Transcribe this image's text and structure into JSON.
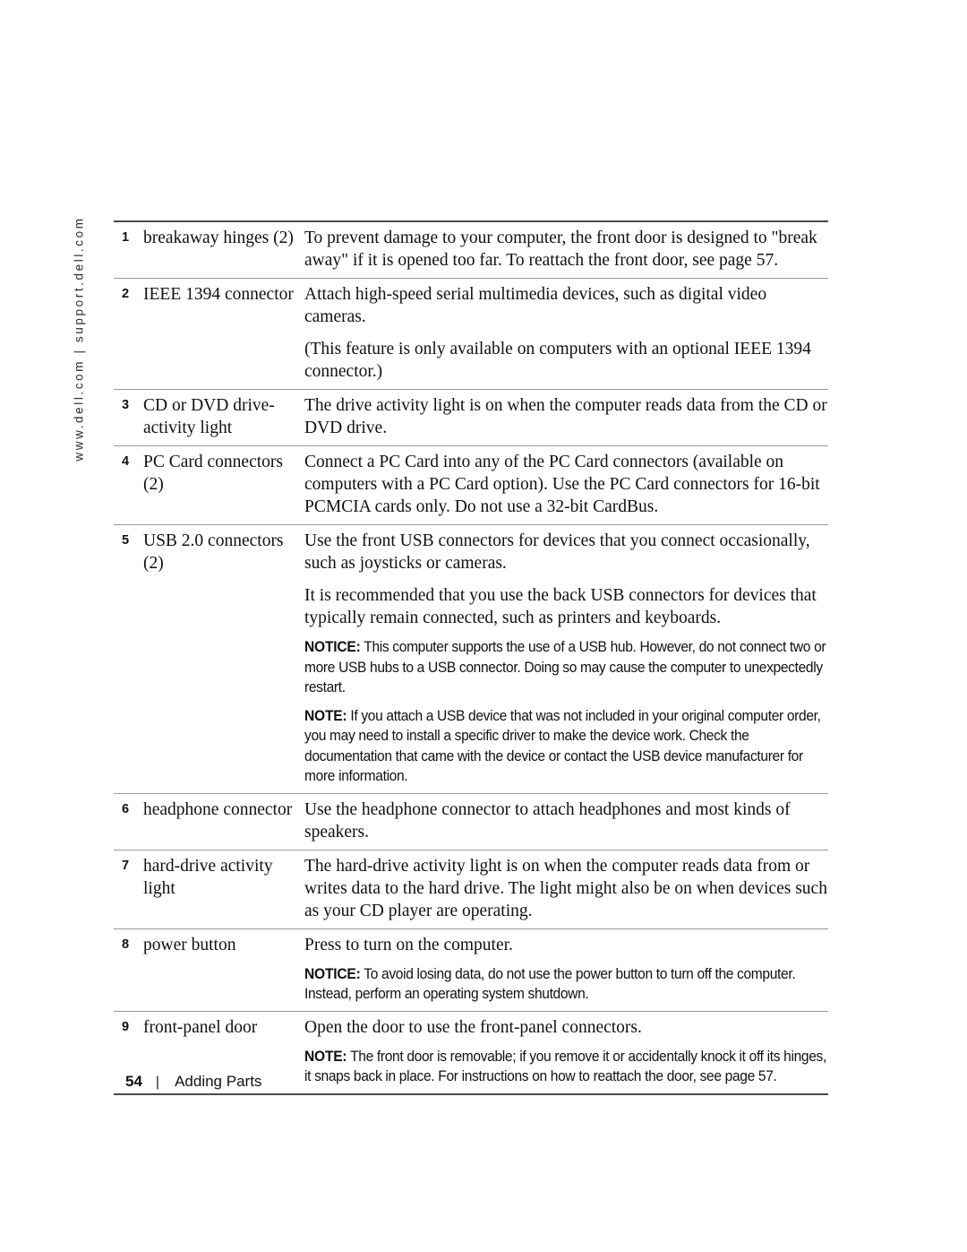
{
  "page": {
    "side_url": "www.dell.com | support.dell.com",
    "footer_page_number": "54",
    "footer_separator": "|",
    "footer_title": "Adding Parts"
  },
  "table": {
    "rows": [
      {
        "num": "1",
        "label": "breakaway hinges (2)",
        "paragraphs": [
          "To prevent damage to your computer, the front door is designed to \"break away\" if it is opened too far. To reattach the front door, see page 57."
        ],
        "admonitions": []
      },
      {
        "num": "2",
        "label": "IEEE 1394 connector",
        "paragraphs": [
          "Attach high-speed serial multimedia devices, such as digital video cameras.",
          "(This feature is only available on computers with an optional IEEE 1394 connector.)"
        ],
        "admonitions": []
      },
      {
        "num": "3",
        "label": "CD or DVD drive-activity light",
        "paragraphs": [
          "The drive activity light is on when the computer reads data from the CD or DVD drive."
        ],
        "admonitions": []
      },
      {
        "num": "4",
        "label": "PC Card connectors (2)",
        "paragraphs": [
          "Connect a PC Card into any of the PC Card connectors (available on computers with a PC Card option). Use the PC Card connectors for 16-bit PCMCIA cards only. Do not use a 32-bit CardBus."
        ],
        "admonitions": []
      },
      {
        "num": "5",
        "label": "USB 2.0 connectors (2)",
        "paragraphs": [
          "Use the front USB connectors for devices that you connect occasionally, such as joysticks or cameras.",
          "It is recommended that you use the back USB connectors for devices that typically remain connected, such as printers and keyboards."
        ],
        "admonitions": [
          {
            "keyword": "NOTICE:",
            "text": " This computer supports the use of a USB hub. However, do not connect two or more USB hubs to a USB connector. Doing so may cause the computer to unexpectedly restart."
          },
          {
            "keyword": "NOTE:",
            "text": " If you attach a USB device that was not included in your original computer order, you may need to install a specific driver to make the device work. Check the documentation that came with the device or contact the USB device manufacturer for more information."
          }
        ]
      },
      {
        "num": "6",
        "label": "headphone connector",
        "paragraphs": [
          "Use the headphone connector to attach headphones and most kinds of speakers."
        ],
        "admonitions": []
      },
      {
        "num": "7",
        "label": "hard-drive activity light",
        "paragraphs": [
          "The hard-drive activity light is on when the computer reads data from or writes data to the hard drive. The light might also be on when devices such as your CD player are operating."
        ],
        "admonitions": []
      },
      {
        "num": "8",
        "label": "power button",
        "paragraphs": [
          "Press to turn on the computer."
        ],
        "admonitions": [
          {
            "keyword": "NOTICE:",
            "text": " To avoid losing data, do not use the power button to turn off the computer. Instead, perform an operating system shutdown."
          }
        ]
      },
      {
        "num": "9",
        "label": "front-panel door",
        "paragraphs": [
          "Open the door to use the front-panel connectors."
        ],
        "admonitions": [
          {
            "keyword": "NOTE:",
            "text": " The front door is removable; if you remove it or accidentally knock it off its hinges, it snaps back in place. For instructions on how to reattach the door, see page 57."
          }
        ]
      }
    ]
  }
}
